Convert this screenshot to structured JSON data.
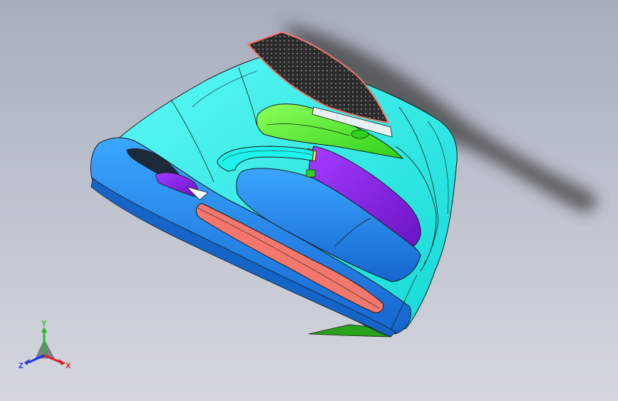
{
  "viewport": {
    "background_top": "#a7adbd",
    "background_bottom": "#d4d7df"
  },
  "model": {
    "colors": {
      "cyan_body": "#1ef3ee",
      "blue_shell": "#1e8ff0",
      "purple_part": "#8a1fe6",
      "green_part": "#52f52c",
      "salmon_strip": "#f2776d",
      "dark_mesh": "#2b2b2b",
      "shadow": "#3c3c3c",
      "edge_lines": "#1a1a1a"
    }
  },
  "triad": {
    "x_label": "X",
    "y_label": "Y",
    "z_label": "Z",
    "x_color": "#e02020",
    "y_color": "#20c020",
    "z_color": "#2030e0"
  }
}
